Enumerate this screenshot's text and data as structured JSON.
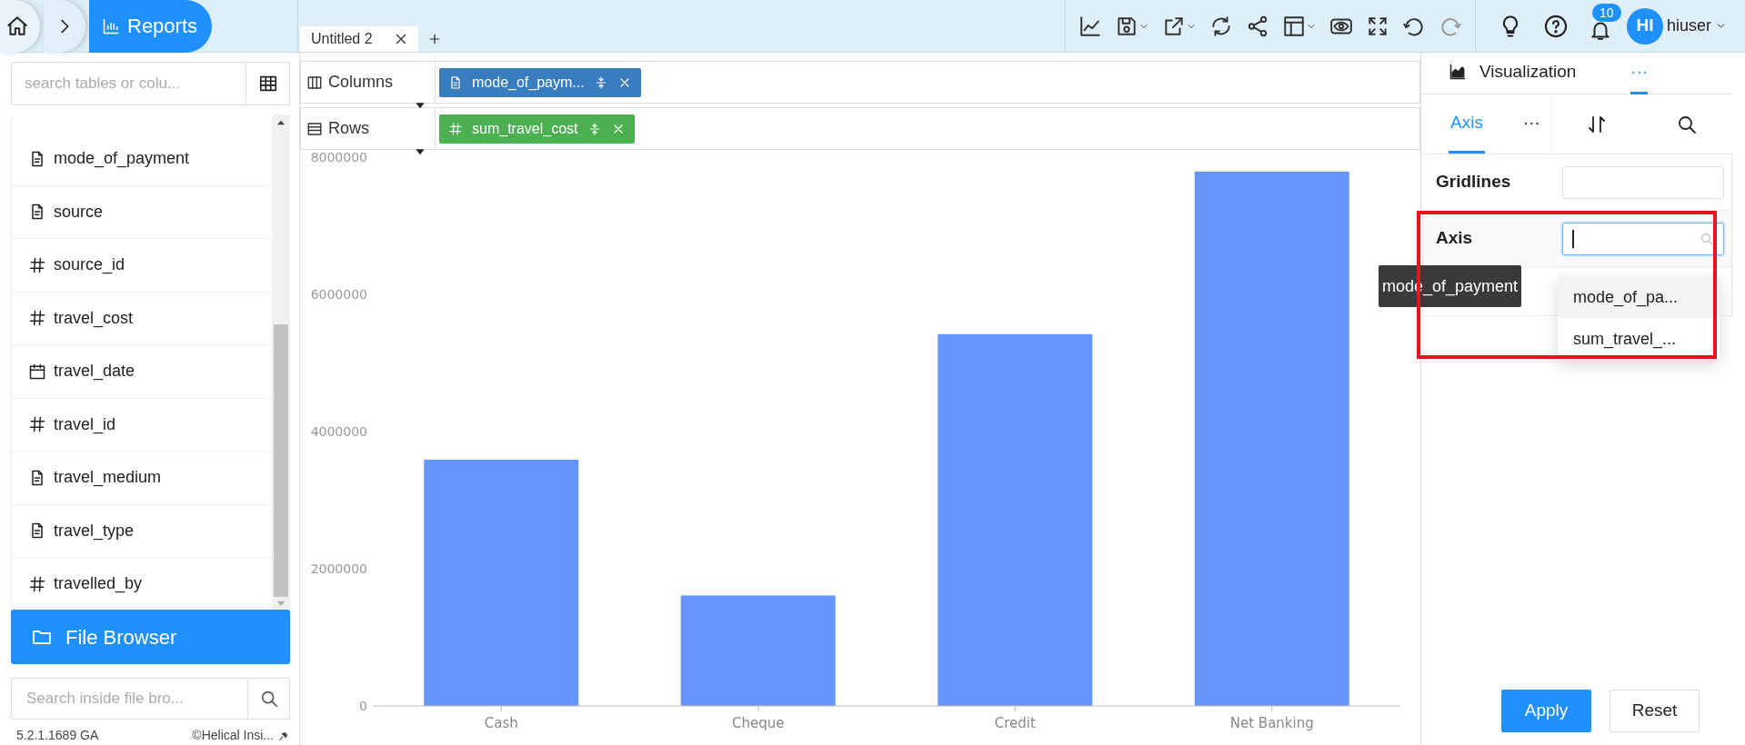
{
  "breadcrumb": {
    "current": "Reports",
    "selected": true
  },
  "tabs": [
    {
      "label": "Untitled 2",
      "selected": true
    }
  ],
  "notifications": {
    "count": "10"
  },
  "user": {
    "initials": "HI",
    "name": "hiuser"
  },
  "field_search": {
    "placeholder": "search tables or colu..."
  },
  "fields": [
    {
      "name": "mode_of_payment",
      "kind": "text"
    },
    {
      "name": "source",
      "kind": "text"
    },
    {
      "name": "source_id",
      "kind": "number"
    },
    {
      "name": "travel_cost",
      "kind": "number"
    },
    {
      "name": "travel_date",
      "kind": "date"
    },
    {
      "name": "travel_id",
      "kind": "number"
    },
    {
      "name": "travel_medium",
      "kind": "text"
    },
    {
      "name": "travel_type",
      "kind": "text"
    },
    {
      "name": "travelled_by",
      "kind": "number"
    }
  ],
  "file_browser": {
    "label": "File Browser"
  },
  "file_search": {
    "placeholder": "Search inside file bro..."
  },
  "footer": {
    "version": "5.2.1.1689 GA",
    "copyright": "©Helical Insi..."
  },
  "shelves": [
    {
      "label": "Columns",
      "kind": "columns",
      "pill": {
        "label": "mode_of_paym...",
        "kind": "dimension"
      }
    },
    {
      "label": "Rows",
      "kind": "rows",
      "pill": {
        "label": "sum_travel_cost",
        "kind": "measure"
      }
    }
  ],
  "chart_data": {
    "type": "bar",
    "categories": [
      "Cash",
      "Cheque",
      "Credit",
      "Net Banking"
    ],
    "values": [
      3590000,
      1610000,
      5420000,
      7790000
    ],
    "ylim": [
      0,
      8000000
    ],
    "yticks": [
      0,
      2000000,
      4000000,
      6000000,
      8000000
    ]
  },
  "right_panel": {
    "tabs": [
      {
        "label": "Visualization",
        "kind": "chart",
        "selected": false
      },
      {
        "label": "···",
        "kind": "more",
        "selected": true
      }
    ],
    "subtabs": [
      {
        "label": "Axis",
        "selected": true
      },
      {
        "label": "···",
        "selected": false
      }
    ],
    "gridlines": {
      "label": "Gridlines"
    },
    "axis": {
      "label": "Axis",
      "focused": true
    },
    "dropdown": [
      {
        "label": "mode_of_pa...",
        "selected": true
      },
      {
        "label": "sum_travel_...",
        "selected": false
      }
    ],
    "tooltip": "mode_of_payment",
    "buttons": [
      {
        "label": "Apply",
        "kind": "primary"
      },
      {
        "label": "Reset",
        "kind": "secondary"
      }
    ]
  }
}
